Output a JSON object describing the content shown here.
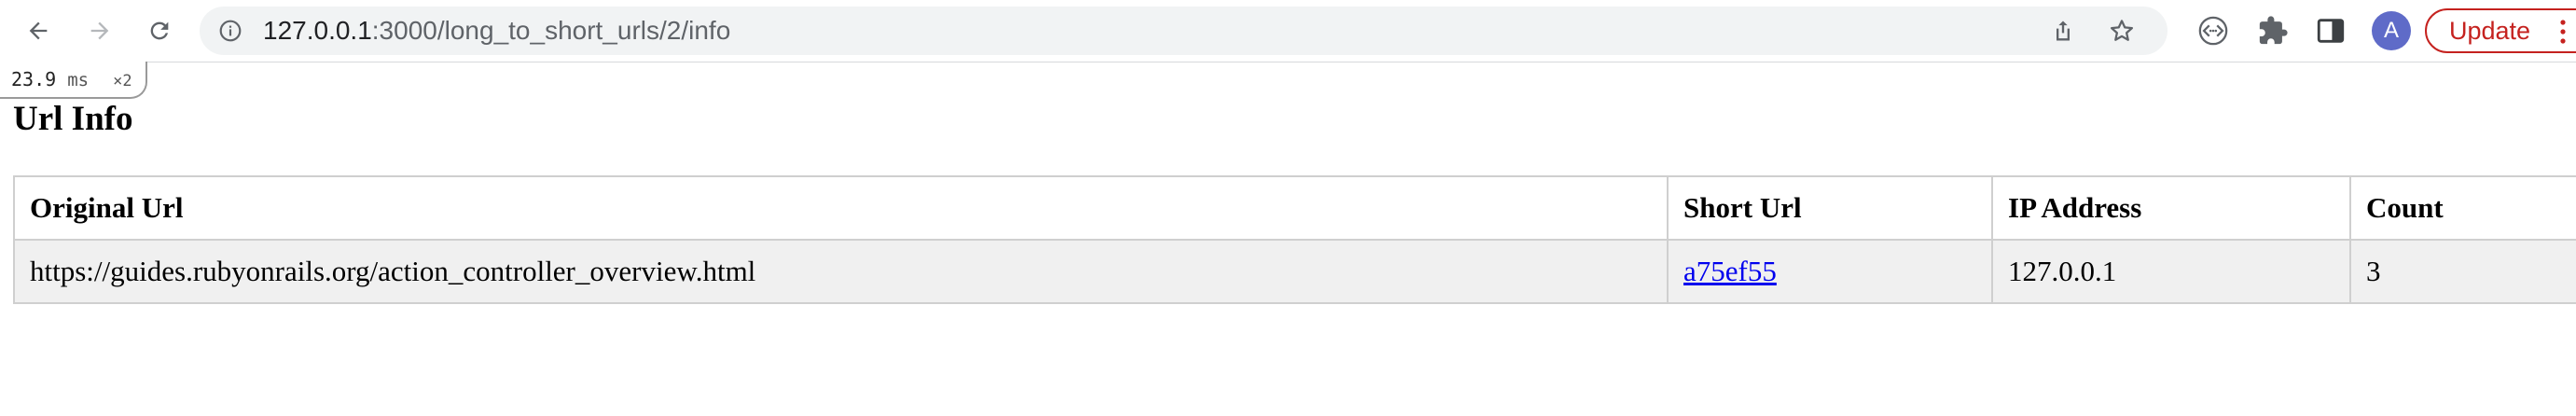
{
  "browser": {
    "url_host": "127.0.0.1",
    "url_path": ":3000/long_to_short_urls/2/info",
    "avatar_letter": "A",
    "update_label": "Update",
    "icons": {
      "back": "arrow-left",
      "forward": "arrow-right",
      "reload": "reload",
      "site_info": "info-circle",
      "share": "share",
      "bookmark": "star",
      "extension_1": "code-circle",
      "extensions": "puzzle-piece",
      "side_panel": "side-panel",
      "menu": "kebab"
    },
    "colors": {
      "update": "#c5221f",
      "avatar": "#5f6bc8"
    }
  },
  "profiler": {
    "time": "23.9",
    "unit": "ms",
    "count": "×2"
  },
  "page": {
    "title": "Url Info",
    "table": {
      "headers": [
        "Original Url",
        "Short Url",
        "IP Address",
        "Count"
      ],
      "rows": [
        {
          "original_url": "https://guides.rubyonrails.org/action_controller_overview.html",
          "short_url": "a75ef55",
          "ip_address": "127.0.0.1",
          "count": "3"
        }
      ]
    },
    "colors": {
      "link": "#0000ee",
      "row_background": "#f0f0f0"
    }
  }
}
